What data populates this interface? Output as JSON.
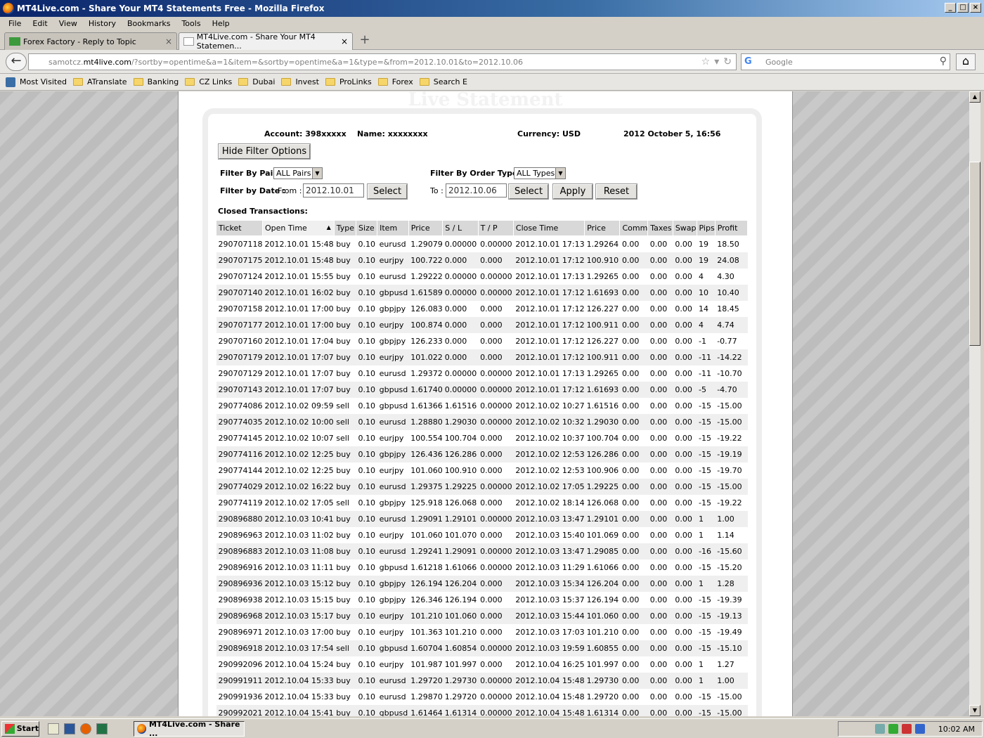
{
  "window": {
    "title": "MT4Live.com - Share Your MT4 Statements Free - Mozilla Firefox"
  },
  "menu": [
    "File",
    "Edit",
    "View",
    "History",
    "Bookmarks",
    "Tools",
    "Help"
  ],
  "tabs": [
    {
      "label": "Forex Factory - Reply to Topic"
    },
    {
      "label": "MT4Live.com - Share Your MT4 Statemen..."
    }
  ],
  "url": {
    "domain_prefix": "samotcz.",
    "domain": "mt4live.com",
    "path": "/?sortby=opentime&a=1&item=&sortby=opentime&a=1&type=&from=2012.10.01&to=2012.10.06"
  },
  "search": {
    "placeholder": "Google"
  },
  "bookmarks": [
    "Most Visited",
    "ATranslate",
    "Banking",
    "CZ Links",
    "Dubai",
    "Invest",
    "ProLinks",
    "Forex",
    "Search E"
  ],
  "page": {
    "header": "Live Statement",
    "account": "Account: 398xxxxx",
    "name": "Name: xxxxxxxx",
    "currency": "Currency: USD",
    "date": "2012 October 5, 16:56",
    "hide_filter": "Hide Filter Options",
    "filter_pair_label": "Filter By Pair:",
    "filter_pair_value": "ALL Pairs",
    "filter_type_label": "Filter By Order Type:",
    "filter_type_value": "ALL Types",
    "filter_date_label": "Filter by Date :",
    "from_label": "From :",
    "from_value": "2012.10.01",
    "to_label": "To :",
    "to_value": "2012.10.06",
    "select_label": "Select",
    "apply_label": "Apply",
    "reset_label": "Reset",
    "closed_label": "Closed Transactions:",
    "columns": [
      "Ticket",
      "Open Time",
      "Type",
      "Size",
      "Item",
      "Price",
      "S / L",
      "T / P",
      "Close Time",
      "Price",
      "Comm",
      "Taxes",
      "Swap",
      "Pips",
      "Profit"
    ],
    "rows": [
      [
        "290707118",
        "2012.10.01 15:48",
        "buy",
        "0.10",
        "eurusd",
        "1.29079",
        "0.00000",
        "0.00000",
        "2012.10.01 17:13",
        "1.29264",
        "0.00",
        "0.00",
        "0.00",
        "19",
        "18.50"
      ],
      [
        "290707175",
        "2012.10.01 15:48",
        "buy",
        "0.10",
        "eurjpy",
        "100.722",
        "0.000",
        "0.000",
        "2012.10.01 17:12",
        "100.910",
        "0.00",
        "0.00",
        "0.00",
        "19",
        "24.08"
      ],
      [
        "290707124",
        "2012.10.01 15:55",
        "buy",
        "0.10",
        "eurusd",
        "1.29222",
        "0.00000",
        "0.00000",
        "2012.10.01 17:13",
        "1.29265",
        "0.00",
        "0.00",
        "0.00",
        "4",
        "4.30"
      ],
      [
        "290707140",
        "2012.10.01 16:02",
        "buy",
        "0.10",
        "gbpusd",
        "1.61589",
        "0.00000",
        "0.00000",
        "2012.10.01 17:12",
        "1.61693",
        "0.00",
        "0.00",
        "0.00",
        "10",
        "10.40"
      ],
      [
        "290707158",
        "2012.10.01 17:00",
        "buy",
        "0.10",
        "gbpjpy",
        "126.083",
        "0.000",
        "0.000",
        "2012.10.01 17:12",
        "126.227",
        "0.00",
        "0.00",
        "0.00",
        "14",
        "18.45"
      ],
      [
        "290707177",
        "2012.10.01 17:00",
        "buy",
        "0.10",
        "eurjpy",
        "100.874",
        "0.000",
        "0.000",
        "2012.10.01 17:12",
        "100.911",
        "0.00",
        "0.00",
        "0.00",
        "4",
        "4.74"
      ],
      [
        "290707160",
        "2012.10.01 17:04",
        "buy",
        "0.10",
        "gbpjpy",
        "126.233",
        "0.000",
        "0.000",
        "2012.10.01 17:12",
        "126.227",
        "0.00",
        "0.00",
        "0.00",
        "-1",
        "-0.77"
      ],
      [
        "290707179",
        "2012.10.01 17:07",
        "buy",
        "0.10",
        "eurjpy",
        "101.022",
        "0.000",
        "0.000",
        "2012.10.01 17:12",
        "100.911",
        "0.00",
        "0.00",
        "0.00",
        "-11",
        "-14.22"
      ],
      [
        "290707129",
        "2012.10.01 17:07",
        "buy",
        "0.10",
        "eurusd",
        "1.29372",
        "0.00000",
        "0.00000",
        "2012.10.01 17:13",
        "1.29265",
        "0.00",
        "0.00",
        "0.00",
        "-11",
        "-10.70"
      ],
      [
        "290707143",
        "2012.10.01 17:07",
        "buy",
        "0.10",
        "gbpusd",
        "1.61740",
        "0.00000",
        "0.00000",
        "2012.10.01 17:12",
        "1.61693",
        "0.00",
        "0.00",
        "0.00",
        "-5",
        "-4.70"
      ],
      [
        "290774086",
        "2012.10.02 09:59",
        "sell",
        "0.10",
        "gbpusd",
        "1.61366",
        "1.61516",
        "0.00000",
        "2012.10.02 10:27",
        "1.61516",
        "0.00",
        "0.00",
        "0.00",
        "-15",
        "-15.00"
      ],
      [
        "290774035",
        "2012.10.02 10:00",
        "sell",
        "0.10",
        "eurusd",
        "1.28880",
        "1.29030",
        "0.00000",
        "2012.10.02 10:32",
        "1.29030",
        "0.00",
        "0.00",
        "0.00",
        "-15",
        "-15.00"
      ],
      [
        "290774145",
        "2012.10.02 10:07",
        "sell",
        "0.10",
        "eurjpy",
        "100.554",
        "100.704",
        "0.000",
        "2012.10.02 10:37",
        "100.704",
        "0.00",
        "0.00",
        "0.00",
        "-15",
        "-19.22"
      ],
      [
        "290774116",
        "2012.10.02 12:25",
        "buy",
        "0.10",
        "gbpjpy",
        "126.436",
        "126.286",
        "0.000",
        "2012.10.02 12:53",
        "126.286",
        "0.00",
        "0.00",
        "0.00",
        "-15",
        "-19.19"
      ],
      [
        "290774144",
        "2012.10.02 12:25",
        "buy",
        "0.10",
        "eurjpy",
        "101.060",
        "100.910",
        "0.000",
        "2012.10.02 12:53",
        "100.906",
        "0.00",
        "0.00",
        "0.00",
        "-15",
        "-19.70"
      ],
      [
        "290774029",
        "2012.10.02 16:22",
        "buy",
        "0.10",
        "eurusd",
        "1.29375",
        "1.29225",
        "0.00000",
        "2012.10.02 17:05",
        "1.29225",
        "0.00",
        "0.00",
        "0.00",
        "-15",
        "-15.00"
      ],
      [
        "290774119",
        "2012.10.02 17:05",
        "sell",
        "0.10",
        "gbpjpy",
        "125.918",
        "126.068",
        "0.000",
        "2012.10.02 18:14",
        "126.068",
        "0.00",
        "0.00",
        "0.00",
        "-15",
        "-19.22"
      ],
      [
        "290896880",
        "2012.10.03 10:41",
        "buy",
        "0.10",
        "eurusd",
        "1.29091",
        "1.29101",
        "0.00000",
        "2012.10.03 13:47",
        "1.29101",
        "0.00",
        "0.00",
        "0.00",
        "1",
        "1.00"
      ],
      [
        "290896963",
        "2012.10.03 11:02",
        "buy",
        "0.10",
        "eurjpy",
        "101.060",
        "101.070",
        "0.000",
        "2012.10.03 15:40",
        "101.069",
        "0.00",
        "0.00",
        "0.00",
        "1",
        "1.14"
      ],
      [
        "290896883",
        "2012.10.03 11:08",
        "buy",
        "0.10",
        "eurusd",
        "1.29241",
        "1.29091",
        "0.00000",
        "2012.10.03 13:47",
        "1.29085",
        "0.00",
        "0.00",
        "0.00",
        "-16",
        "-15.60"
      ],
      [
        "290896916",
        "2012.10.03 11:11",
        "buy",
        "0.10",
        "gbpusd",
        "1.61218",
        "1.61066",
        "0.00000",
        "2012.10.03 11:29",
        "1.61066",
        "0.00",
        "0.00",
        "0.00",
        "-15",
        "-15.20"
      ],
      [
        "290896936",
        "2012.10.03 15:12",
        "buy",
        "0.10",
        "gbpjpy",
        "126.194",
        "126.204",
        "0.000",
        "2012.10.03 15:34",
        "126.204",
        "0.00",
        "0.00",
        "0.00",
        "1",
        "1.28"
      ],
      [
        "290896938",
        "2012.10.03 15:15",
        "buy",
        "0.10",
        "gbpjpy",
        "126.346",
        "126.194",
        "0.000",
        "2012.10.03 15:37",
        "126.194",
        "0.00",
        "0.00",
        "0.00",
        "-15",
        "-19.39"
      ],
      [
        "290896968",
        "2012.10.03 15:17",
        "buy",
        "0.10",
        "eurjpy",
        "101.210",
        "101.060",
        "0.000",
        "2012.10.03 15:44",
        "101.060",
        "0.00",
        "0.00",
        "0.00",
        "-15",
        "-19.13"
      ],
      [
        "290896971",
        "2012.10.03 17:00",
        "buy",
        "0.10",
        "eurjpy",
        "101.363",
        "101.210",
        "0.000",
        "2012.10.03 17:03",
        "101.210",
        "0.00",
        "0.00",
        "0.00",
        "-15",
        "-19.49"
      ],
      [
        "290896918",
        "2012.10.03 17:54",
        "sell",
        "0.10",
        "gbpusd",
        "1.60704",
        "1.60854",
        "0.00000",
        "2012.10.03 19:59",
        "1.60855",
        "0.00",
        "0.00",
        "0.00",
        "-15",
        "-15.10"
      ],
      [
        "290992096",
        "2012.10.04 15:24",
        "buy",
        "0.10",
        "eurjpy",
        "101.987",
        "101.997",
        "0.000",
        "2012.10.04 16:25",
        "101.997",
        "0.00",
        "0.00",
        "0.00",
        "1",
        "1.27"
      ],
      [
        "290991911",
        "2012.10.04 15:33",
        "buy",
        "0.10",
        "eurusd",
        "1.29720",
        "1.29730",
        "0.00000",
        "2012.10.04 15:48",
        "1.29730",
        "0.00",
        "0.00",
        "0.00",
        "1",
        "1.00"
      ],
      [
        "290991936",
        "2012.10.04 15:33",
        "buy",
        "0.10",
        "eurusd",
        "1.29870",
        "1.29720",
        "0.00000",
        "2012.10.04 15:48",
        "1.29720",
        "0.00",
        "0.00",
        "0.00",
        "-15",
        "-15.00"
      ],
      [
        "290992021",
        "2012.10.04 15:41",
        "buy",
        "0.10",
        "gbpusd",
        "1.61464",
        "1.61314",
        "0.00000",
        "2012.10.04 15:48",
        "1.61314",
        "0.00",
        "0.00",
        "0.00",
        "-15",
        "-15.00"
      ]
    ]
  },
  "taskbar": {
    "start": "Start",
    "item": "MT4Live.com - Share ...",
    "time": "10:02 AM"
  }
}
